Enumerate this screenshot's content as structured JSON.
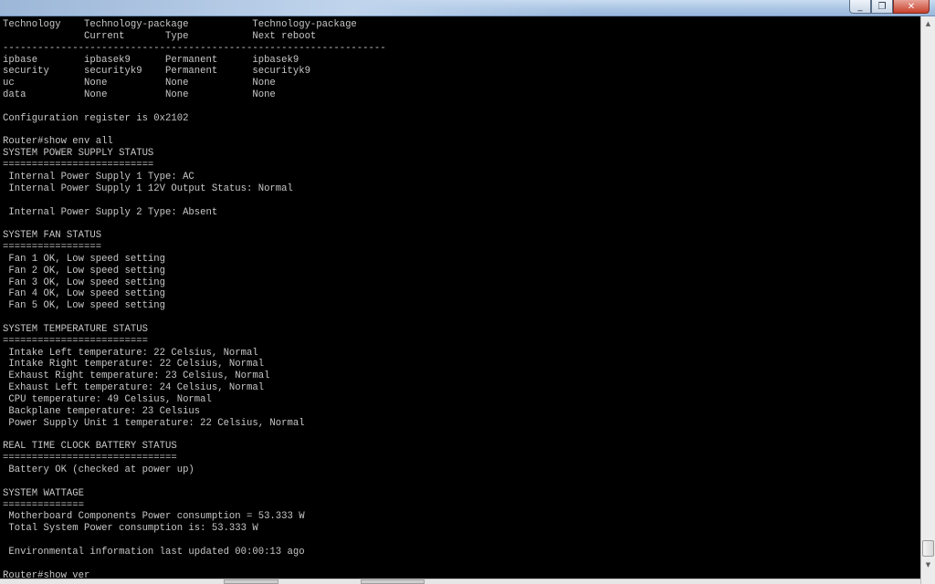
{
  "window": {
    "minimize_glyph": "_",
    "maximize_glyph": "❐",
    "close_glyph": "✕"
  },
  "terminal": {
    "lines": [
      "Technology    Technology-package           Technology-package",
      "              Current       Type           Next reboot",
      "------------------------------------------------------------------",
      "ipbase        ipbasek9      Permanent      ipbasek9",
      "security      securityk9    Permanent      securityk9",
      "uc            None          None           None",
      "data          None          None           None",
      "",
      "Configuration register is 0x2102",
      "",
      "Router#show env all",
      "SYSTEM POWER SUPPLY STATUS",
      "==========================",
      " Internal Power Supply 1 Type: AC",
      " Internal Power Supply 1 12V Output Status: Normal",
      "",
      " Internal Power Supply 2 Type: Absent",
      "",
      "SYSTEM FAN STATUS",
      "=================",
      " Fan 1 OK, Low speed setting",
      " Fan 2 OK, Low speed setting",
      " Fan 3 OK, Low speed setting",
      " Fan 4 OK, Low speed setting",
      " Fan 5 OK, Low speed setting",
      "",
      "SYSTEM TEMPERATURE STATUS",
      "=========================",
      " Intake Left temperature: 22 Celsius, Normal",
      " Intake Right temperature: 22 Celsius, Normal",
      " Exhaust Right temperature: 23 Celsius, Normal",
      " Exhaust Left temperature: 24 Celsius, Normal",
      " CPU temperature: 49 Celsius, Normal",
      " Backplane temperature: 23 Celsius",
      " Power Supply Unit 1 temperature: 22 Celsius, Normal",
      "",
      "REAL TIME CLOCK BATTERY STATUS",
      "==============================",
      " Battery OK (checked at power up)",
      "",
      "SYSTEM WATTAGE",
      "==============",
      " Motherboard Components Power consumption = 53.333 W",
      " Total System Power consumption is: 53.333 W",
      "",
      " Environmental information last updated 00:00:13 ago",
      "",
      "Router#show ver"
    ]
  },
  "scrollbar": {
    "up_glyph": "▲",
    "down_glyph": "▼"
  }
}
